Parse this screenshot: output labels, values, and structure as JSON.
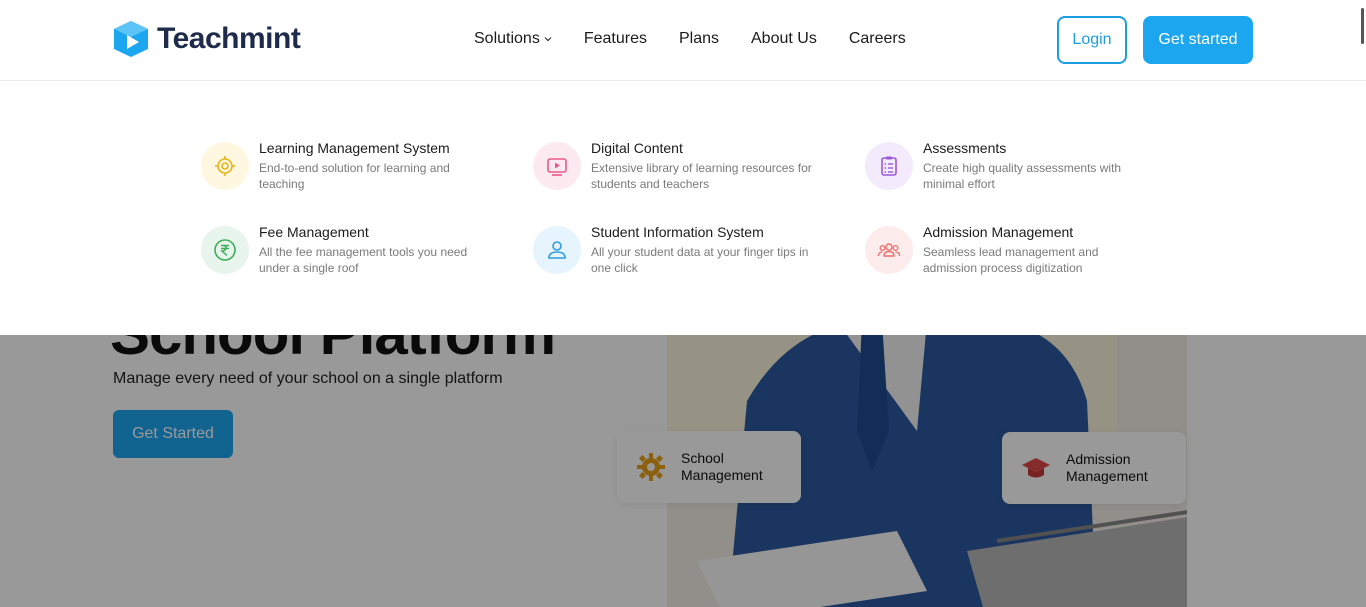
{
  "header": {
    "logo_text": "Teachmint",
    "nav": {
      "solutions": "Solutions",
      "features": "Features",
      "plans": "Plans",
      "about": "About Us",
      "careers": "Careers"
    },
    "login_label": "Login",
    "get_started_label": "Get started"
  },
  "dropdown": {
    "items": [
      {
        "title": "Learning Management System",
        "desc": "End-to-end solution for learning and teaching",
        "icon": "gear-icon",
        "color": "#e8b21c"
      },
      {
        "title": "Digital Content",
        "desc": "Extensive library of learning resources for students and teachers",
        "icon": "video-play-icon",
        "color": "#e95a8a"
      },
      {
        "title": "Assessments",
        "desc": "Create high quality assessments with minimal effort",
        "icon": "clipboard-icon",
        "color": "#9b59d6"
      },
      {
        "title": "Fee Management",
        "desc": "All the fee management tools you need under a single roof",
        "icon": "rupee-icon",
        "color": "#3fae5a"
      },
      {
        "title": "Student Information System",
        "desc": "All your student data at your finger tips in one click",
        "icon": "user-icon",
        "color": "#2f9be0"
      },
      {
        "title": "Admission Management",
        "desc": "Seamless lead management and admission process digitization",
        "icon": "people-icon",
        "color": "#ee6f6f"
      }
    ]
  },
  "hero": {
    "title": "School Platform",
    "subtitle": "Manage every need of your school on a single platform",
    "cta": "Get Started",
    "card_school": "School Management",
    "card_admission": "Admission Management"
  },
  "colors": {
    "accent": "#1da6f0",
    "brand_dark": "#1e2b4a"
  }
}
